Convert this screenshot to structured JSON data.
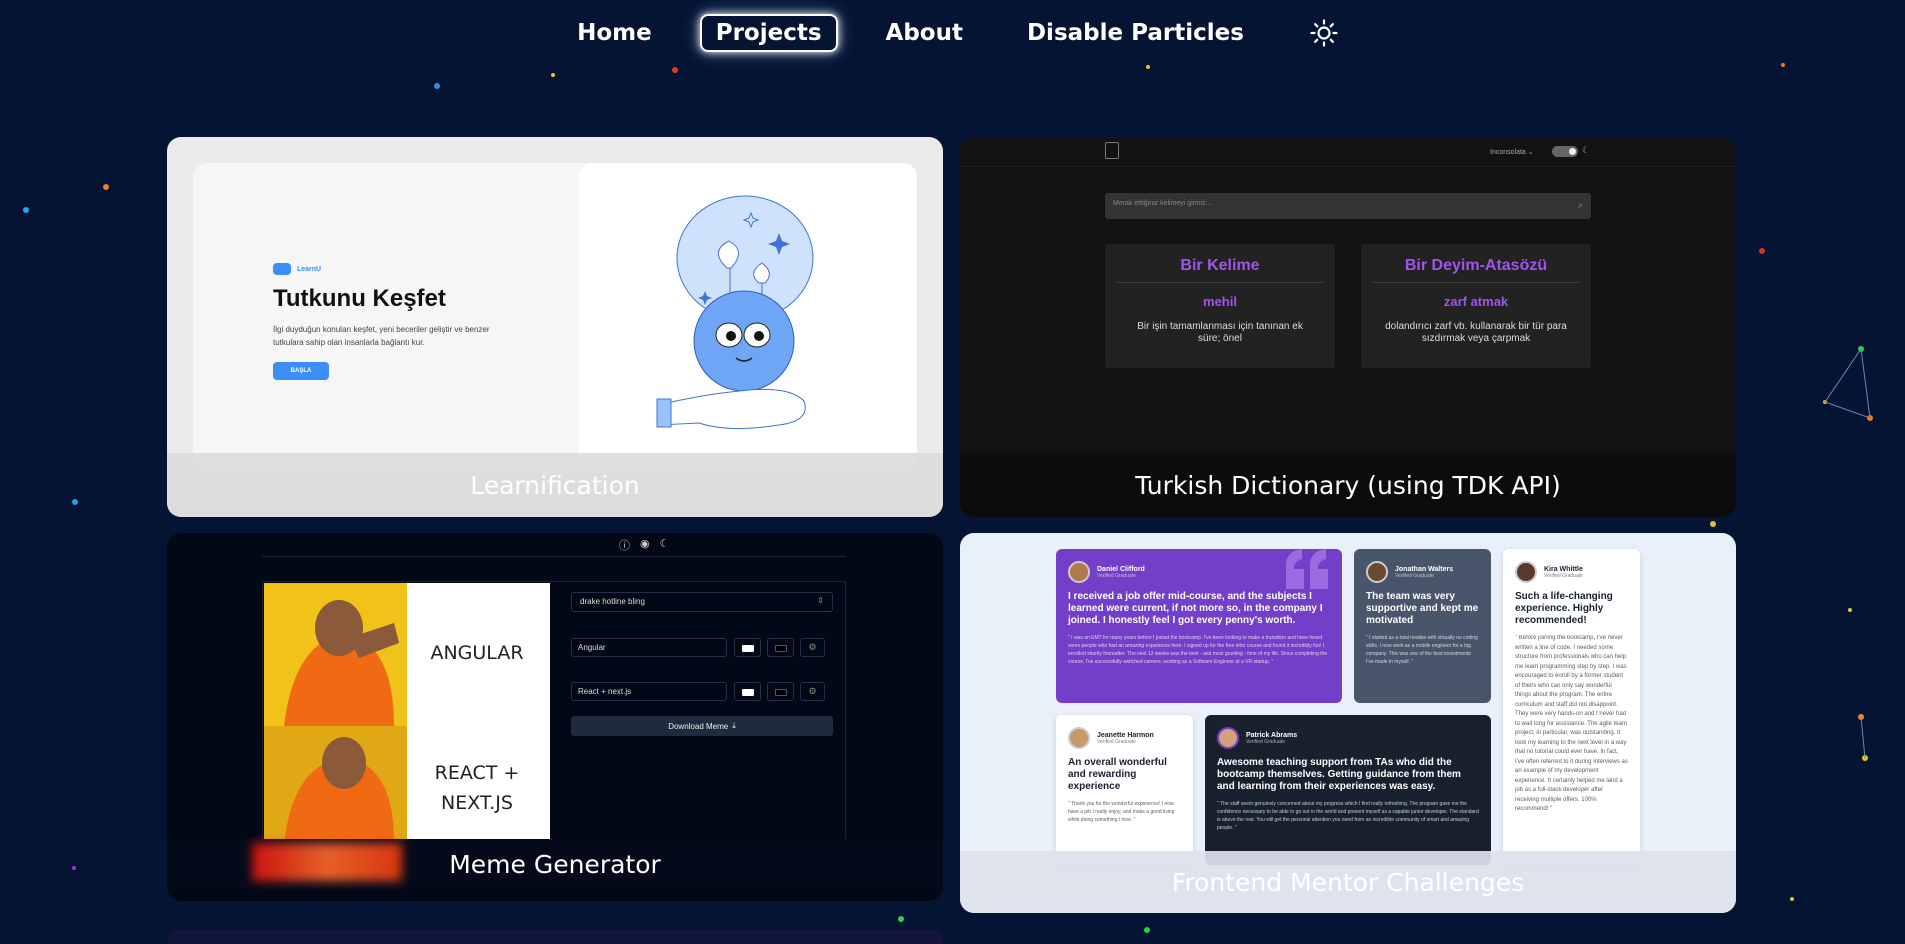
{
  "colors": {
    "background": "#061434",
    "dictionary_accent": "#a353ec",
    "learn_accent": "#3d8ef7",
    "fm_violet": "#733fc8",
    "fm_slate": "#48556a",
    "fm_dark": "#19212e"
  },
  "nav": {
    "home": "Home",
    "projects": "Projects",
    "about": "About",
    "particles": "Disable Particles",
    "theme_icon": "sun-icon"
  },
  "projects": {
    "learnification": {
      "caption": "Learnification",
      "logo": "LearnU",
      "title": "Tutkunu Keşfet",
      "description": "İlgi duyduğun konuları keşfet, yeni beceriler geliştir ve benzer tutkulara sahip olan insanlarla bağlantı kur.",
      "button": "BAŞLA"
    },
    "dictionary": {
      "caption": "Turkish Dictionary (using TDK API)",
      "language": "Inconsolata ⌄",
      "search_placeholder": "Merak ettiğiniz kelimeyi giriniz...",
      "word_box": {
        "title": "Bir Kelime",
        "word": "mehil",
        "definition": "Bir işin tamamlanması için tanınan ek süre; önel"
      },
      "idiom_box": {
        "title": "Bir Deyim-Atasözü",
        "word": "zarf atmak",
        "definition": "dolandırıcı zarf vb. kullanarak bir tür para sızdırmak veya çarpmak"
      }
    },
    "meme": {
      "caption": "Meme Generator",
      "template": "drake hotline bling",
      "text1": "Angular",
      "text2": "React + next.js",
      "download": "Download Meme",
      "meme_top": "ANGULAR",
      "meme_bottom": "REACT + NEXT.JS"
    },
    "frontend_mentor": {
      "caption": "Frontend Mentor Challenges",
      "testimonials": [
        {
          "name": "Daniel Clifford",
          "role": "Verified Graduate",
          "headline": "I received a job offer mid-course, and the subjects I learned were current, if not more so, in the company I joined. I honestly feel I got every penny's worth.",
          "quote": "\" I was an EMT for many years before I joined the bootcamp. I've been looking to make a transition and have heard some people who had an amazing experience here. I signed up for the free intro course and found it incredibly fun! I enrolled shortly thereafter. The next 12 weeks was the best - and most grueling - time of my life. Since completing the course, I've successfully switched careers, working as a Software Engineer at a VR startup. \""
        },
        {
          "name": "Jonathan Walters",
          "role": "Verified Graduate",
          "headline": "The team was very supportive and kept me motivated",
          "quote": "\" I started as a total newbie with virtually no coding skills. I now work as a mobile engineer for a big company. This was one of the best investments I've made in myself. \""
        },
        {
          "name": "Kira Whittle",
          "role": "Verified Graduate",
          "headline": "Such a life-changing experience. Highly recommended!",
          "quote": "\" Before joining the bootcamp, I've never written a line of code. I needed some structure from professionals who can help me learn programming step by step. I was encouraged to enroll by a former student of theirs who can only say wonderful things about the program. The entire curriculum and staff did not disappoint. They were very hands-on and I never had to wait long for assistance. The agile team project, in particular, was outstanding. It took my learning to the next level in a way that no tutorial could ever have. In fact, I've often referred to it during interviews as an example of my development experience. It certainly helped me land a job as a full-stack developer after receiving multiple offers. 100% recommend! \""
        },
        {
          "name": "Jeanette Harmon",
          "role": "Verified Graduate",
          "headline": "An overall wonderful and rewarding experience",
          "quote": "\" Thank you for the wonderful experience! I now have a job I really enjoy, and make a good living while doing something I love. \""
        },
        {
          "name": "Patrick Abrams",
          "role": "Verified Graduate",
          "headline": "Awesome teaching support from TAs who did the bootcamp themselves. Getting guidance from them and learning from their experiences was easy.",
          "quote": "\" The staff seem genuinely concerned about my progress which I find really refreshing. The program gave me the confidence necessary to be able to go out in the world and present myself as a capable junior developer. The standard is above the rest. You will get the personal attention you need from an incredible community of smart and amazing people. \""
        }
      ]
    }
  }
}
